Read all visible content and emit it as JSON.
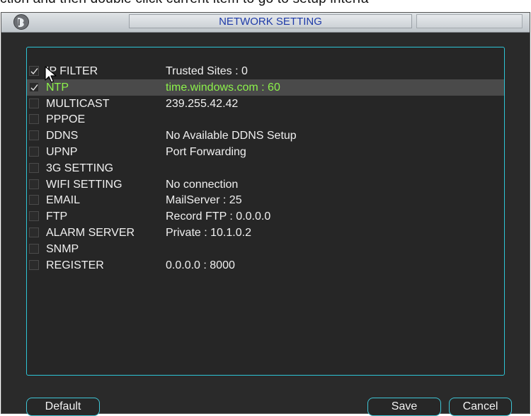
{
  "top_text": "ction and then double click current item to go to setup interfa",
  "window": {
    "title": "NETWORK SETTING"
  },
  "icons": {
    "logo": "dahua-logo-icon",
    "cursor": "mouse-pointer-icon",
    "check": "check-icon"
  },
  "colors": {
    "accent": "#2ec4d6",
    "selected_text": "#8cf24a",
    "title_text": "#1e3aa8"
  },
  "items": [
    {
      "name": "IP FILTER",
      "value": "Trusted Sites : 0",
      "checked": true,
      "selected": false
    },
    {
      "name": "NTP",
      "value": "time.windows.com : 60",
      "checked": true,
      "selected": true
    },
    {
      "name": "MULTICAST",
      "value": "239.255.42.42",
      "checked": false,
      "selected": false
    },
    {
      "name": "PPPOE",
      "value": "",
      "checked": false,
      "selected": false
    },
    {
      "name": "DDNS",
      "value": "No Available DDNS Setup",
      "checked": false,
      "selected": false
    },
    {
      "name": "UPNP",
      "value": "Port Forwarding",
      "checked": false,
      "selected": false
    },
    {
      "name": "3G SETTING",
      "value": "",
      "checked": false,
      "selected": false
    },
    {
      "name": "WIFI SETTING",
      "value": "No connection",
      "checked": false,
      "selected": false
    },
    {
      "name": "EMAIL",
      "value": "MailServer : 25",
      "checked": false,
      "selected": false
    },
    {
      "name": "FTP",
      "value": "Record FTP : 0.0.0.0",
      "checked": false,
      "selected": false
    },
    {
      "name": "ALARM SERVER",
      "value": "Private : 10.1.0.2",
      "checked": false,
      "selected": false
    },
    {
      "name": "SNMP",
      "value": "",
      "checked": false,
      "selected": false
    },
    {
      "name": "REGISTER",
      "value": "0.0.0.0 : 8000",
      "checked": false,
      "selected": false
    }
  ],
  "buttons": {
    "default": "Default",
    "save": "Save",
    "cancel": "Cancel"
  }
}
